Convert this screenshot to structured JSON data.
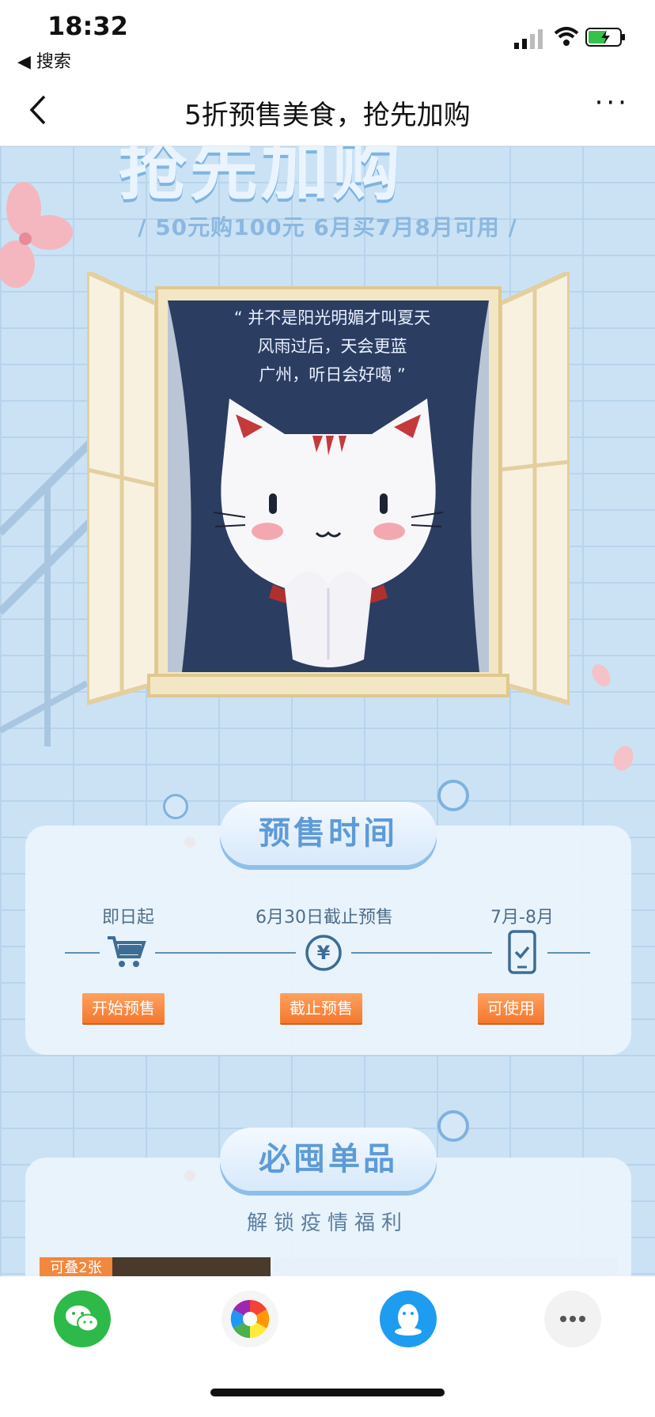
{
  "status": {
    "time": "18:32",
    "back_app": "◀ 搜索"
  },
  "nav": {
    "title": "5折预售美食，抢先加购",
    "more": "···"
  },
  "hero": {
    "headline_tail": "抢先加购",
    "subline": "/ 50元购100元  6月买7月8月可用 /",
    "quote_lines": [
      "“ 并不是阳光明媚才叫夏天",
      "风雨过后，天会更蓝",
      "广州，听日会好噶 ”"
    ]
  },
  "presale": {
    "title": "预售时间",
    "steps": [
      {
        "date": "即日起",
        "icon": "cart-icon",
        "button": "开始预售"
      },
      {
        "date": "6月30日截止预售",
        "icon": "yen-icon",
        "button": "截止预售"
      },
      {
        "date": "7月-8月",
        "icon": "phone-check-icon",
        "button": "可使用"
      }
    ]
  },
  "must_buy": {
    "title": "必囤单品",
    "subtitle": "解锁疫情福利",
    "badge": "可叠2张"
  },
  "colors": {
    "accent": "#5d9bd6",
    "button": "#f4782d",
    "background": "#cbe2f5"
  }
}
